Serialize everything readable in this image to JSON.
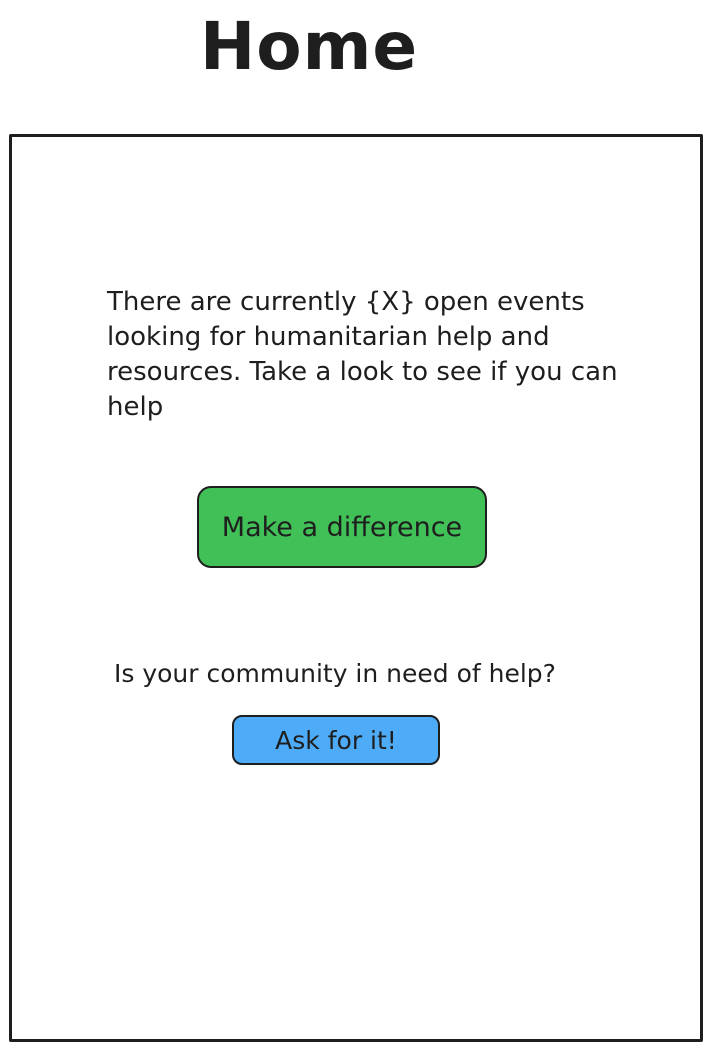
{
  "header": {
    "title": "Home"
  },
  "main": {
    "intro_text": "There are currently {X} open events looking for humanitarian help and resources. Take a look to see if you can help",
    "primary_button_label": "Make a difference",
    "question_text": "Is your community in need of help?",
    "secondary_button_label": "Ask for it!"
  },
  "colors": {
    "primary_button": "#40c057",
    "secondary_button": "#4dabf7",
    "stroke": "#1e1e1e"
  }
}
